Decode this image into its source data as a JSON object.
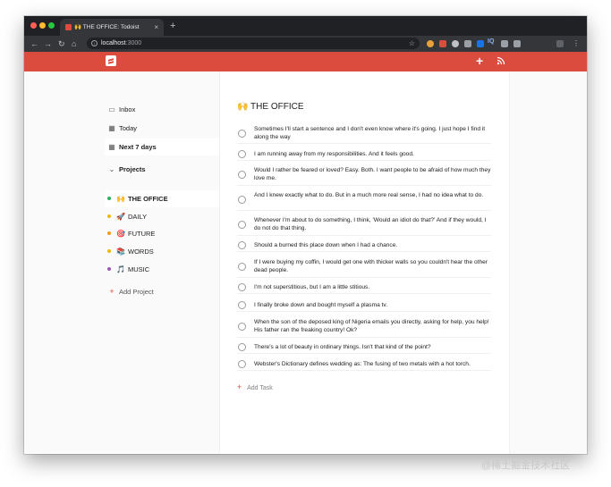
{
  "browser": {
    "tab_title": "🙌 THE OFFICE: Todoist",
    "tab_close": "×",
    "new_tab": "+",
    "url_host": "localhost",
    "url_port": ":3000",
    "info_glyph": "i",
    "star": "☆",
    "ext_label": "IQ"
  },
  "nav": {
    "back": "←",
    "forward": "→",
    "reload": "↻",
    "home": "⌂"
  },
  "header": {
    "add": "+",
    "accent": "#db4c3f"
  },
  "sidebar": {
    "inbox": "Inbox",
    "today": "Today",
    "next7": "Next 7 days",
    "projects_heading": "Projects",
    "add_project": "Add Project",
    "projects": [
      {
        "emoji": "🙌",
        "name": "THE OFFICE",
        "color": "#29b35f"
      },
      {
        "emoji": "🚀",
        "name": "DAILY",
        "color": "#f2b705"
      },
      {
        "emoji": "🎯",
        "name": "FUTURE",
        "color": "#f39c12"
      },
      {
        "emoji": "📚",
        "name": "WORDS",
        "color": "#f2b705"
      },
      {
        "emoji": "🎵",
        "name": "MUSIC",
        "color": "#9b59b6"
      }
    ]
  },
  "main": {
    "title": "🙌 THE OFFICE",
    "add_task": "Add Task",
    "tasks": [
      "Sometimes I'll start a sentence and I don't even know where it's going. I just hope I find it along the way",
      "I am running away from my responsibilities. And it feels good.",
      "Would I rather be feared or loved? Easy. Both. I want people to be afraid of how much they love me.",
      "And I knew exactly what to do. But in a much more real sense, I had no idea what to do.",
      "Whenever I'm about to do something, I think, 'Would an idiot do that?' And if they would, I do not do that thing.",
      "Should a burned this place down when I had a chance.",
      "If I were buying my coffin, I would get one with thicker walls so you couldn't hear the other dead people.",
      "I'm not superstitious, but I am a little stitious.",
      "I finally broke down and bought myself a plasma tv.",
      "When the son of the deposed king of Nigeria emails you directly, asking for help, you help! His father ran the freaking country! Ok?",
      "There's a lot of beauty in ordinary things. Isn't that kind of the point?",
      "Webster's Dictionary defines wedding as: The fusing of two metals with a hot torch."
    ]
  },
  "watermark": "@稀土掘金技术社区"
}
